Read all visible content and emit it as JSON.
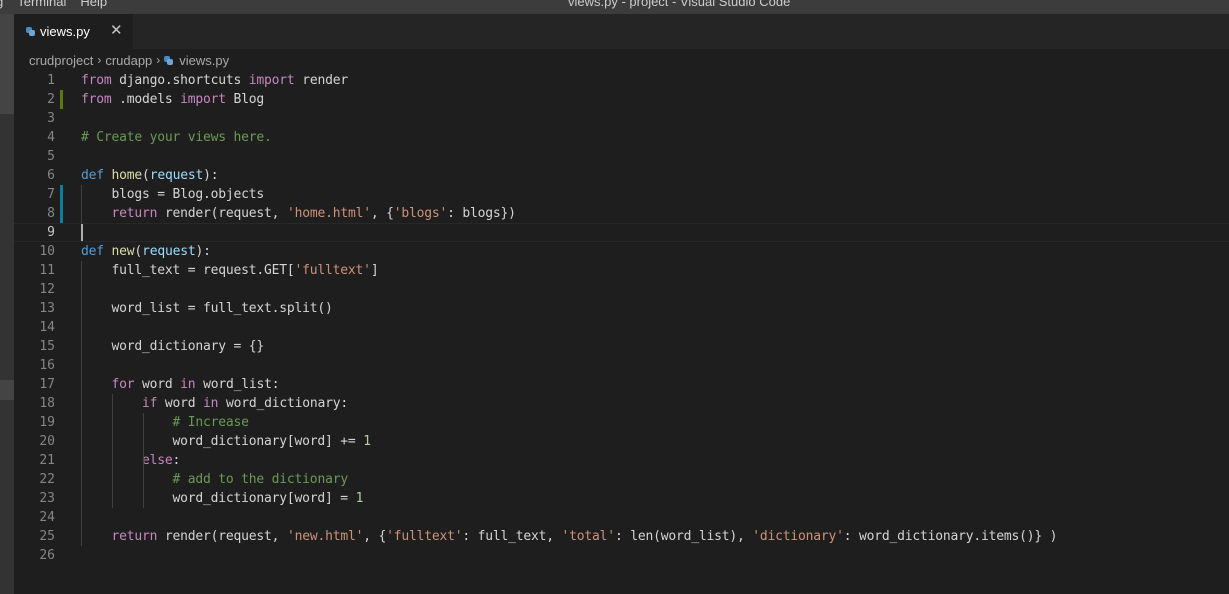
{
  "titlebar": {
    "menu": [
      "g",
      "Terminal",
      "Help"
    ],
    "window_title": "views.py - project - Visual Studio Code"
  },
  "tab": {
    "label": "views.py",
    "close_glyph": "✕",
    "icon": "python-file-icon"
  },
  "breadcrumbs": [
    "crudproject",
    "crudapp",
    "views.py"
  ],
  "breadcrumb_separator": "›",
  "colors": {
    "keyword": "#c586c0",
    "storage": "#569cd6",
    "function": "#dcdcaa",
    "parameter": "#9cdcfe",
    "string": "#ce9178",
    "comment": "#6a9955",
    "number": "#b5cea8",
    "text": "#d4d4d4",
    "modified_marker": "#0c7d9d",
    "added_marker": "#587c0c"
  },
  "editor": {
    "current_line": 9,
    "lines": [
      {
        "n": "1",
        "tokens": [
          [
            "kw",
            "from"
          ],
          [
            "t",
            " django.shortcuts "
          ],
          [
            "kw",
            "import"
          ],
          [
            "t",
            " render"
          ]
        ]
      },
      {
        "n": "2",
        "tokens": [
          [
            "kw",
            "from"
          ],
          [
            "t",
            " .models "
          ],
          [
            "kw",
            "import"
          ],
          [
            "t",
            " Blog"
          ]
        ]
      },
      {
        "n": "3",
        "tokens": []
      },
      {
        "n": "4",
        "tokens": [
          [
            "cmt",
            "# Create your views here."
          ]
        ]
      },
      {
        "n": "5",
        "tokens": []
      },
      {
        "n": "6",
        "tokens": [
          [
            "def",
            "def"
          ],
          [
            "t",
            " "
          ],
          [
            "fn",
            "home"
          ],
          [
            "t",
            "("
          ],
          [
            "param",
            "request"
          ],
          [
            "t",
            "):"
          ]
        ]
      },
      {
        "n": "7",
        "tokens": [
          [
            "t",
            "    blogs = Blog.objects"
          ]
        ]
      },
      {
        "n": "8",
        "tokens": [
          [
            "t",
            "    "
          ],
          [
            "kw",
            "return"
          ],
          [
            "t",
            " render(request, "
          ],
          [
            "str",
            "'home.html'"
          ],
          [
            "t",
            ", {"
          ],
          [
            "str",
            "'blogs'"
          ],
          [
            "t",
            ": blogs})"
          ]
        ]
      },
      {
        "n": "9",
        "tokens": []
      },
      {
        "n": "10",
        "tokens": [
          [
            "def",
            "def"
          ],
          [
            "t",
            " "
          ],
          [
            "fn",
            "new"
          ],
          [
            "t",
            "("
          ],
          [
            "param",
            "request"
          ],
          [
            "t",
            "):"
          ]
        ]
      },
      {
        "n": "11",
        "tokens": [
          [
            "t",
            "    full_text = request.GET["
          ],
          [
            "str",
            "'fulltext'"
          ],
          [
            "t",
            "]"
          ]
        ]
      },
      {
        "n": "12",
        "tokens": []
      },
      {
        "n": "13",
        "tokens": [
          [
            "t",
            "    word_list = full_text.split()"
          ]
        ]
      },
      {
        "n": "14",
        "tokens": []
      },
      {
        "n": "15",
        "tokens": [
          [
            "t",
            "    word_dictionary = {}"
          ]
        ]
      },
      {
        "n": "16",
        "tokens": []
      },
      {
        "n": "17",
        "tokens": [
          [
            "t",
            "    "
          ],
          [
            "kw",
            "for"
          ],
          [
            "t",
            " word "
          ],
          [
            "kw",
            "in"
          ],
          [
            "t",
            " word_list:"
          ]
        ]
      },
      {
        "n": "18",
        "tokens": [
          [
            "t",
            "        "
          ],
          [
            "kw",
            "if"
          ],
          [
            "t",
            " word "
          ],
          [
            "kw",
            "in"
          ],
          [
            "t",
            " word_dictionary:"
          ]
        ]
      },
      {
        "n": "19",
        "tokens": [
          [
            "t",
            "            "
          ],
          [
            "cmt",
            "# Increase"
          ]
        ]
      },
      {
        "n": "20",
        "tokens": [
          [
            "t",
            "            word_dictionary[word] += "
          ],
          [
            "num",
            "1"
          ]
        ]
      },
      {
        "n": "21",
        "tokens": [
          [
            "t",
            "        "
          ],
          [
            "kw",
            "else"
          ],
          [
            "t",
            ":"
          ]
        ]
      },
      {
        "n": "22",
        "tokens": [
          [
            "t",
            "            "
          ],
          [
            "cmt",
            "# add to the dictionary"
          ]
        ]
      },
      {
        "n": "23",
        "tokens": [
          [
            "t",
            "            word_dictionary[word] = "
          ],
          [
            "num",
            "1"
          ]
        ]
      },
      {
        "n": "24",
        "tokens": []
      },
      {
        "n": "25",
        "tokens": [
          [
            "t",
            "    "
          ],
          [
            "kw",
            "return"
          ],
          [
            "t",
            " render(request, "
          ],
          [
            "str",
            "'new.html'"
          ],
          [
            "t",
            ", {"
          ],
          [
            "str",
            "'fulltext'"
          ],
          [
            "t",
            ": full_text, "
          ],
          [
            "str",
            "'total'"
          ],
          [
            "t",
            ": len(word_list), "
          ],
          [
            "str",
            "'dictionary'"
          ],
          [
            "t",
            ": word_dictionary.items()} )"
          ]
        ]
      },
      {
        "n": "26",
        "tokens": []
      }
    ],
    "gutter_markers": [
      {
        "line": 2,
        "kind": "added"
      },
      {
        "line": 7,
        "kind": "modified"
      },
      {
        "line": 8,
        "kind": "modified"
      }
    ]
  }
}
